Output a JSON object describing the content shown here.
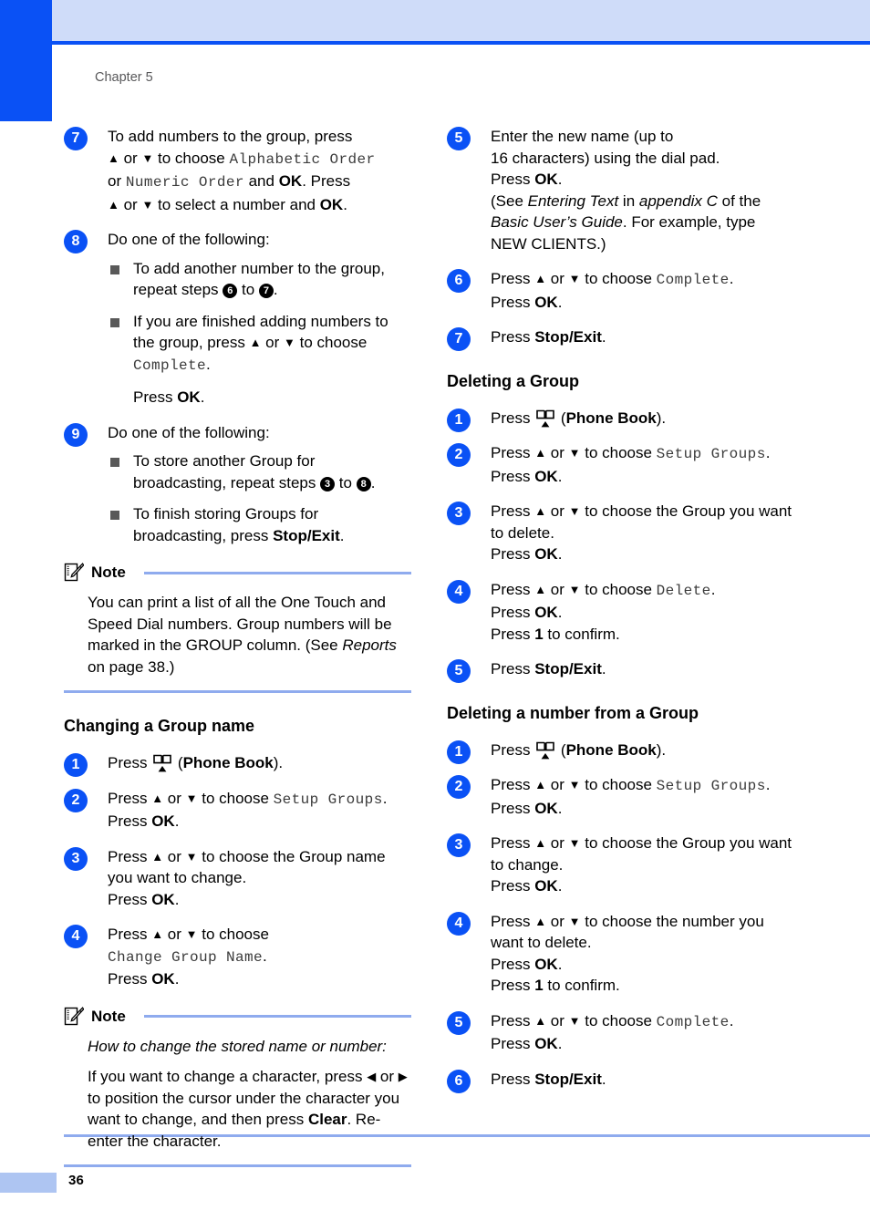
{
  "page": {
    "chapter_label": "Chapter 5",
    "page_number": "36",
    "accent_blue": "#0a51f5",
    "band_blue": "#cfdcf9",
    "rule_blue": "#8fabee"
  },
  "icons": {
    "phone_book": "phone-book-icon",
    "note": "note-pencil-icon"
  },
  "left_column": {
    "steps": [
      {
        "num": "7",
        "lines_html": "To add numbers to the group, press<br><span class=\"arrow\">▲</span> or <span class=\"arrow\">▼</span> to choose <span class=\"mono\">Alphabetic Order</span><br>or <span class=\"mono\">Numeric Order</span> and <b>OK</b>. Press<br><span class=\"arrow\">▲</span> or <span class=\"arrow\">▼</span> to select a number and <b>OK</b>."
      },
      {
        "num": "8",
        "lines_html": "Do one of the following:",
        "bullets_html": [
          "To add another number to the group, repeat steps <span class=\"ref\">6</span> to <span class=\"ref\">7</span>.",
          "If you are finished adding numbers to the group, press <span class=\"arrow\">▲</span> or <span class=\"arrow\">▼</span> to choose <span class=\"mono\">Complete</span>."
        ],
        "after_html": "Press <b>OK</b>."
      },
      {
        "num": "9",
        "lines_html": "Do one of the following:",
        "bullets_html": [
          "To store another Group for broadcasting, repeat steps <span class=\"ref\">3</span> to <span class=\"ref\">8</span>.",
          "To finish storing Groups for broadcasting, press <b>Stop/Exit</b>."
        ]
      }
    ],
    "note_1": {
      "title": "Note",
      "paragraphs_html": [
        "You can print a list of all the One Touch and Speed Dial numbers. Group numbers will be marked in the GROUP column. (See <span class=\"ital\">Reports</span> on page 38.)"
      ]
    },
    "section_title": "Changing a Group name",
    "section_steps": [
      {
        "num": "1",
        "lines_html": "Press <span class=\"pbicon-slot\"></span> (<b>Phone Book</b>)."
      },
      {
        "num": "2",
        "lines_html": "Press <span class=\"arrow\">▲</span> or <span class=\"arrow\">▼</span> to choose <span class=\"mono\">Setup Groups</span>.<br>Press <b>OK</b>."
      },
      {
        "num": "3",
        "lines_html": "Press <span class=\"arrow\">▲</span> or <span class=\"arrow\">▼</span> to choose the Group name you want to change.<br>Press <b>OK</b>."
      },
      {
        "num": "4",
        "lines_html": "Press <span class=\"arrow\">▲</span> or <span class=\"arrow\">▼</span> to choose<br><span class=\"mono\">Change Group Name</span>.<br>Press <b>OK</b>."
      }
    ],
    "note_2": {
      "title": "Note",
      "paragraphs_html": [
        "<span class=\"ital\">How to change the stored name or number:</span>",
        "If you want to change a character, press <span class=\"arrow\">◀</span> or <span class=\"arrow\">▶</span> to position the cursor under the character you want to change, and then press <b>Clear</b>. Re-enter the character."
      ]
    }
  },
  "right_column": {
    "steps_top": [
      {
        "num": "5",
        "lines_html": "Enter the new name (up to<br>16 characters) using the dial pad.<br>Press <b>OK</b>.<br>(See <span class=\"ital\">Entering Text</span> in <span class=\"ital\">appendix C</span> of the <span class=\"ital\">Basic User’s Guide</span>. For example, type NEW CLIENTS.)"
      },
      {
        "num": "6",
        "lines_html": "Press <span class=\"arrow\">▲</span> or <span class=\"arrow\">▼</span> to choose <span class=\"mono\">Complete</span>.<br>Press <b>OK</b>."
      },
      {
        "num": "7",
        "lines_html": "Press <b>Stop/Exit</b>."
      }
    ],
    "section_delete_group": {
      "title": "Deleting a Group",
      "steps": [
        {
          "num": "1",
          "lines_html": "Press <span class=\"pbicon-slot\"></span> (<b>Phone Book</b>)."
        },
        {
          "num": "2",
          "lines_html": "Press <span class=\"arrow\">▲</span> or <span class=\"arrow\">▼</span> to choose <span class=\"mono\">Setup Groups</span>.<br>Press <b>OK</b>."
        },
        {
          "num": "3",
          "lines_html": "Press <span class=\"arrow\">▲</span> or <span class=\"arrow\">▼</span> to choose the Group you want to delete.<br>Press <b>OK</b>."
        },
        {
          "num": "4",
          "lines_html": "Press <span class=\"arrow\">▲</span> or <span class=\"arrow\">▼</span> to choose <span class=\"mono\">Delete</span>.<br>Press <b>OK</b>.<br>Press <b>1</b> to confirm."
        },
        {
          "num": "5",
          "lines_html": "Press <b>Stop/Exit</b>."
        }
      ]
    },
    "section_delete_number": {
      "title": "Deleting a number from a Group",
      "steps": [
        {
          "num": "1",
          "lines_html": "Press <span class=\"pbicon-slot\"></span> (<b>Phone Book</b>)."
        },
        {
          "num": "2",
          "lines_html": "Press <span class=\"arrow\">▲</span> or <span class=\"arrow\">▼</span> to choose <span class=\"mono\">Setup Groups</span>.<br>Press <b>OK</b>."
        },
        {
          "num": "3",
          "lines_html": "Press <span class=\"arrow\">▲</span> or <span class=\"arrow\">▼</span> to choose the Group you want to change.<br>Press <b>OK</b>."
        },
        {
          "num": "4",
          "lines_html": "Press <span class=\"arrow\">▲</span> or <span class=\"arrow\">▼</span> to choose the number you want to delete.<br>Press <b>OK</b>.<br>Press <b>1</b> to confirm."
        },
        {
          "num": "5",
          "lines_html": "Press <span class=\"arrow\">▲</span> or <span class=\"arrow\">▼</span> to choose <span class=\"mono\">Complete</span>.<br>Press <b>OK</b>."
        },
        {
          "num": "6",
          "lines_html": "Press <b>Stop/Exit</b>."
        }
      ]
    }
  }
}
